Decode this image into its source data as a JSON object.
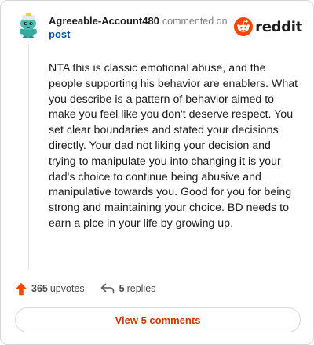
{
  "comment": {
    "author": "Agreeable-Account480",
    "action_text": "commented on",
    "link_text": "post",
    "body": "NTA this is classic emotional abuse, and the people supporting his behavior are enablers. What you describe is a pattern of behavior aimed to make you feel like you don't deserve respect. You set clear boundaries and stated your decisions directly. Your dad not liking your decision and trying to manipulate you into changing it is your dad's choice to continue being abusive and manipulative towards you. Good for you for being strong and maintaining your choice. BD needs to earn a plce in your life by growing up."
  },
  "brand": {
    "wordmark": "reddit",
    "icon": "reddit-snoo-icon",
    "accent_color": "#ff4500"
  },
  "footer": {
    "upvote_count": "365",
    "upvote_label": "upvotes",
    "reply_count": "5",
    "reply_label": "replies",
    "view_button_label": "View 5 comments"
  },
  "colors": {
    "author_text": "#1c1c1c",
    "link_text": "#0b4a9c",
    "muted_text": "#7c7c7c",
    "upvote_arrow": "#ff4500",
    "view_button_text": "#c23b00"
  }
}
